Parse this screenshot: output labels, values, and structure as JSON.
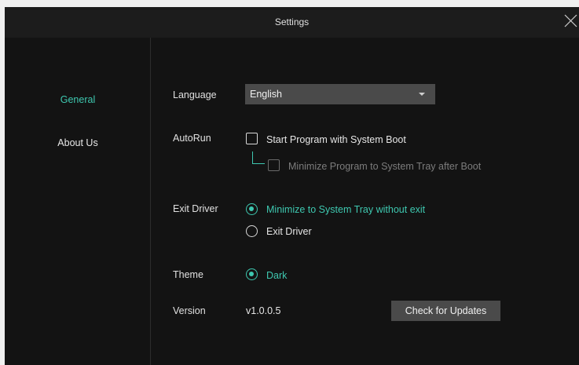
{
  "window": {
    "title": "Settings"
  },
  "sidebar": {
    "items": [
      {
        "label": "General",
        "active": true
      },
      {
        "label": "About Us",
        "active": false
      }
    ]
  },
  "general": {
    "language": {
      "label": "Language",
      "value": "English"
    },
    "autorun": {
      "label": "AutoRun",
      "start_with_boot": {
        "label": "Start Program with System Boot",
        "checked": false
      },
      "minimize_after_boot": {
        "label": "Minimize Program to System Tray after Boot",
        "checked": false,
        "enabled": false
      }
    },
    "exit_driver": {
      "label": "Exit Driver",
      "options": [
        {
          "label": "Minimize to System Tray without exit",
          "selected": true
        },
        {
          "label": "Exit Driver",
          "selected": false
        }
      ]
    },
    "theme": {
      "label": "Theme",
      "options": [
        {
          "label": "Dark",
          "selected": true
        }
      ]
    },
    "version": {
      "label": "Version",
      "value": "v1.0.0.5",
      "check_button": "Check for Updates"
    }
  },
  "colors": {
    "accent": "#3ec8b0",
    "background": "#131313",
    "titlebar": "#1c1c1c",
    "control": "#4a4a4a"
  },
  "icons": {
    "close": "close-icon",
    "dropdown": "chevron-down-icon"
  }
}
